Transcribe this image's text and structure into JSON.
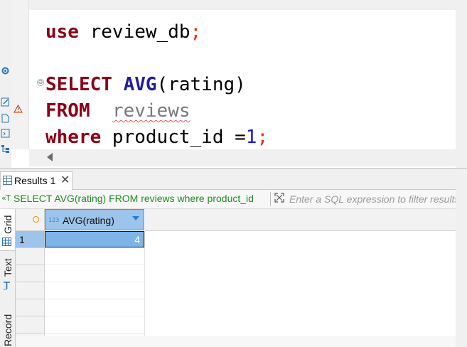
{
  "editor": {
    "lines": [
      {
        "parts": [
          {
            "t": "use",
            "c": "kw"
          },
          {
            "t": " ",
            "c": "id"
          },
          {
            "t": "review_db",
            "c": "id"
          },
          {
            "t": ";",
            "c": "semi"
          }
        ]
      },
      {
        "parts": [
          {
            "t": "SELECT",
            "c": "kw"
          },
          {
            "t": " ",
            "c": "id"
          },
          {
            "t": "AVG",
            "c": "fn"
          },
          {
            "t": "(rating)",
            "c": "id"
          }
        ]
      },
      {
        "parts": [
          {
            "t": "FROM",
            "c": "kw"
          },
          {
            "t": "  ",
            "c": "id"
          },
          {
            "t": "reviews",
            "c": "tbl"
          }
        ]
      },
      {
        "parts": [
          {
            "t": "where",
            "c": "kw"
          },
          {
            "t": " product_id =",
            "c": "id"
          },
          {
            "t": "1",
            "c": "num"
          },
          {
            "t": ";",
            "c": "semi"
          }
        ]
      }
    ],
    "fold_marker": "⊖"
  },
  "results": {
    "tab_label": "Results 1",
    "tab_close": "✕",
    "query_icon": "«T",
    "query_text": "SELECT AVG(rating) FROM reviews where product_id",
    "filter_placeholder": "Enter a SQL expression to filter results",
    "side_tabs": {
      "grid": "Grid",
      "text": "Text",
      "record": "Record"
    },
    "column": {
      "type_badge": "123",
      "name": "AVG(rating)"
    },
    "rows": [
      {
        "num": "1",
        "value": "4"
      }
    ]
  },
  "colors": {
    "keyword": "#8b0016",
    "function": "#1f1f9c",
    "number": "#1616d6",
    "semicolon": "#ff2200",
    "query_green": "#238b23",
    "selection_blue": "#7fb4e8"
  },
  "icons": [
    "gear-icon",
    "edit-icon",
    "warning-icon",
    "file-icon",
    "script-icon",
    "tree-icon",
    "grid-icon",
    "expand-icon",
    "sort-icon"
  ]
}
